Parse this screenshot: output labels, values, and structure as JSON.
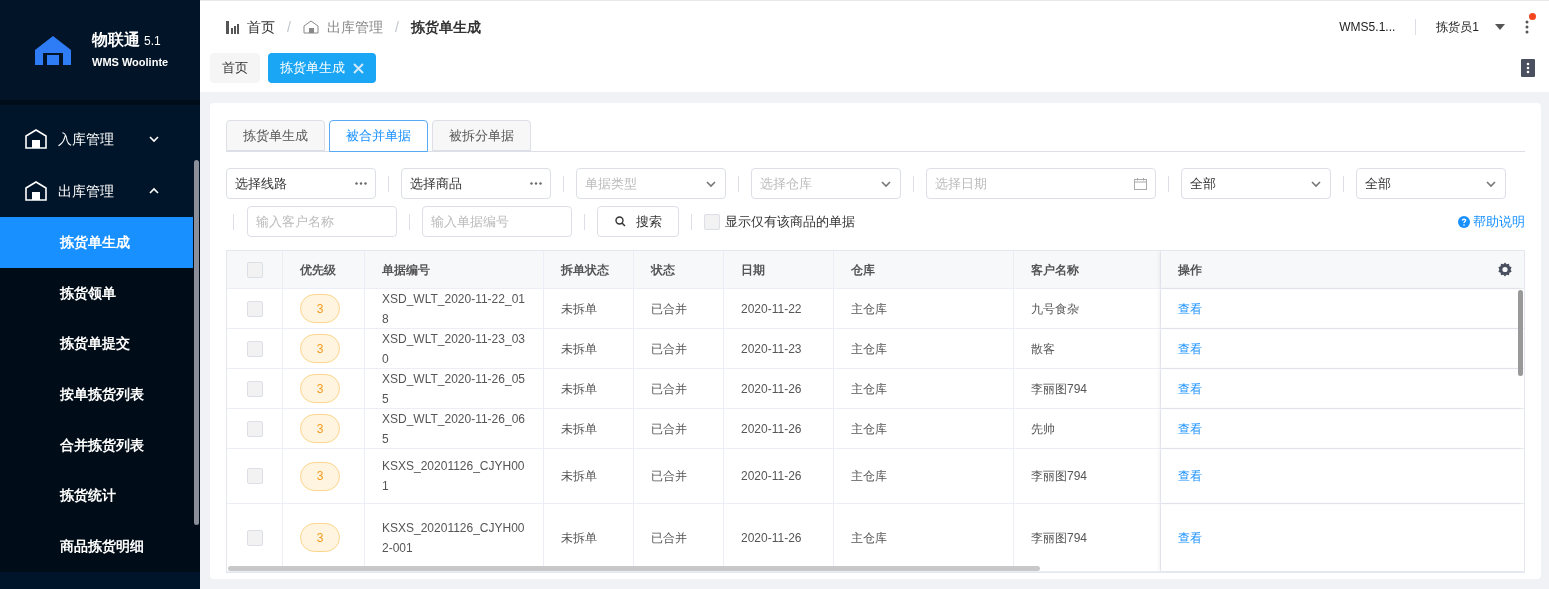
{
  "logo": {
    "name": "物联通",
    "version": "5.1",
    "subtitle": "WMS Woolinte"
  },
  "sidebar": {
    "items": [
      {
        "label": "入库管理",
        "expanded": false
      },
      {
        "label": "出库管理",
        "expanded": true,
        "children": [
          {
            "label": "拣货单生成",
            "selected": true
          },
          {
            "label": "拣货领单",
            "selected": false
          },
          {
            "label": "拣货单提交",
            "selected": false
          },
          {
            "label": "按单拣货列表",
            "selected": false
          },
          {
            "label": "合并拣货列表",
            "selected": false
          },
          {
            "label": "拣货统计",
            "selected": false
          },
          {
            "label": "商品拣货明细",
            "selected": false
          }
        ]
      }
    ]
  },
  "breadcrumb": [
    {
      "label": "首页"
    },
    {
      "separator": "/",
      "label": "出库管理"
    },
    {
      "separator": "/",
      "label": "拣货单生成"
    }
  ],
  "header": {
    "version": "WMS5.1...",
    "user": "拣货员1",
    "has_notification": true
  },
  "page_tabs": [
    {
      "label": "首页",
      "selected": false
    },
    {
      "label": "拣货单生成",
      "selected": true
    }
  ],
  "content_tabs": [
    {
      "label": "拣货单生成",
      "selected": false
    },
    {
      "label": "被合并单据",
      "selected": true
    },
    {
      "label": "被拆分单据",
      "selected": false
    }
  ],
  "filters": [
    {
      "kind": "picker",
      "value": "选择线路"
    },
    {
      "kind": "picker",
      "value": "选择商品"
    },
    {
      "kind": "select",
      "placeholder": "单据类型"
    },
    {
      "kind": "select",
      "placeholder": "选择仓库"
    },
    {
      "kind": "date",
      "placeholder": "选择日期"
    },
    {
      "kind": "select",
      "value": "全部"
    },
    {
      "kind": "select",
      "value": "全部"
    }
  ],
  "search_fields": [
    {
      "placeholder": "输入客户名称"
    },
    {
      "placeholder": "输入单据编号"
    }
  ],
  "search_button": "搜索",
  "only_product_checkbox": {
    "label": "显示仅有该商品的单据",
    "checked": false
  },
  "help_link": "帮助说明",
  "table": {
    "select_all": {
      "checked": false
    },
    "columns": [
      "优先级",
      "单据编号",
      "拆单状态",
      "状态",
      "日期",
      "仓库",
      "客户名称",
      "操作"
    ],
    "rows": [
      {
        "checked": false,
        "priority": "3",
        "id": "XSD_WLT_2020-11-22_018",
        "split_status": "未拆单",
        "status": "已合并",
        "date": "2020-11-22",
        "warehouse": "主仓库",
        "customer": "九号食杂",
        "action": "查看"
      },
      {
        "checked": false,
        "priority": "3",
        "id": "XSD_WLT_2020-11-23_030",
        "split_status": "未拆单",
        "status": "已合并",
        "date": "2020-11-23",
        "warehouse": "主仓库",
        "customer": "散客",
        "action": "查看"
      },
      {
        "checked": false,
        "priority": "3",
        "id": "XSD_WLT_2020-11-26_055",
        "split_status": "未拆单",
        "status": "已合并",
        "date": "2020-11-26",
        "warehouse": "主仓库",
        "customer": "李丽图794",
        "action": "查看"
      },
      {
        "checked": false,
        "priority": "3",
        "id": "XSD_WLT_2020-11-26_065",
        "split_status": "未拆单",
        "status": "已合并",
        "date": "2020-11-26",
        "warehouse": "主仓库",
        "customer": "先帅",
        "action": "查看"
      },
      {
        "checked": false,
        "priority": "3",
        "id": "KSXS_20201126_CJYH001",
        "split_status": "未拆单",
        "status": "已合并",
        "date": "2020-11-26",
        "warehouse": "主仓库",
        "customer": "李丽图794",
        "action": "查看"
      },
      {
        "checked": false,
        "priority": "3",
        "id": "KSXS_20201126_CJYH002-001",
        "split_status": "未拆单",
        "status": "已合并",
        "date": "2020-11-26",
        "warehouse": "主仓库",
        "customer": "李丽图794",
        "action": "查看"
      }
    ]
  }
}
